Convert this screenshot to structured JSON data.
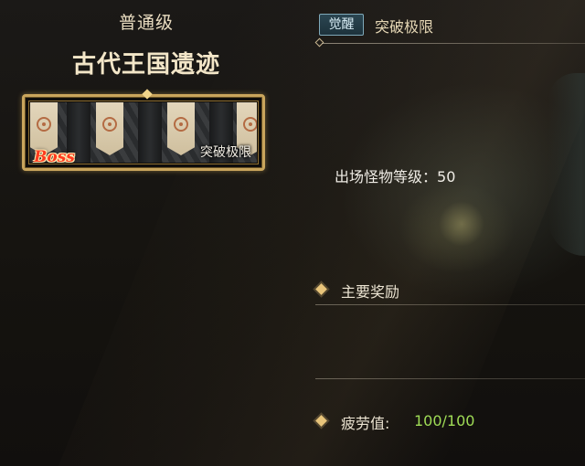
{
  "dungeon": {
    "difficulty": "普通级",
    "name": "古代王国遗迹",
    "banner_badge": "Boss",
    "banner_tag": "突破极限"
  },
  "header": {
    "mode_badge": "觉醒",
    "mode_title": "突破极限"
  },
  "info": {
    "monster_level_label": "出场怪物等级：",
    "monster_level_value": "50"
  },
  "rewards": {
    "label": "主要奖励"
  },
  "fatigue": {
    "label": "疲劳值:",
    "value": "100/100"
  },
  "colors": {
    "gold": "#e8c47a",
    "boss_red": "#ff3b1f",
    "fatigue_green": "#9fdc56",
    "badge_teal": "#2b4652"
  }
}
